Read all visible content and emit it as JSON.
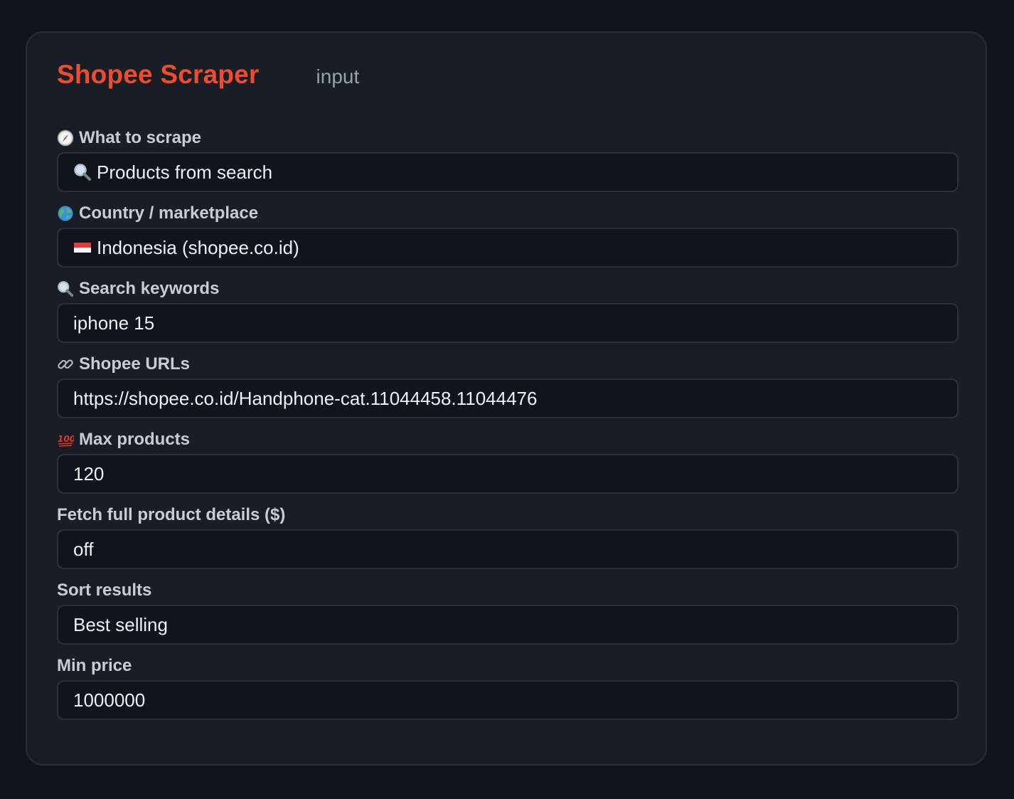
{
  "header": {
    "title": "Shopee Scraper",
    "subtitle": "input"
  },
  "colors": {
    "brand": "#ee4d2d",
    "page_bg": "#10131b",
    "card_bg": "#191d26",
    "field_bg": "#10141d",
    "field_border": "#2b303b"
  },
  "fields": [
    {
      "label": "What to scrape",
      "label_icon": "compass-icon",
      "value": "Products from search",
      "value_icon": "magnifier-icon"
    },
    {
      "label": "Country / marketplace",
      "label_icon": "globe-icon",
      "value": "Indonesia (shopee.co.id)",
      "value_icon": "indonesia-flag-icon"
    },
    {
      "label": "Search keywords",
      "label_icon": "magnifier-icon",
      "value": "iphone 15"
    },
    {
      "label": "Shopee URLs",
      "label_icon": "link-icon",
      "value": "https://shopee.co.id/Handphone-cat.11044458.11044476"
    },
    {
      "label": "Max products",
      "label_icon": "hundred-points-icon",
      "value": "120"
    },
    {
      "label": "Fetch full product details ($)",
      "value": "off"
    },
    {
      "label": "Sort results",
      "value": "Best selling"
    },
    {
      "label": "Min price",
      "value": "1000000"
    }
  ]
}
